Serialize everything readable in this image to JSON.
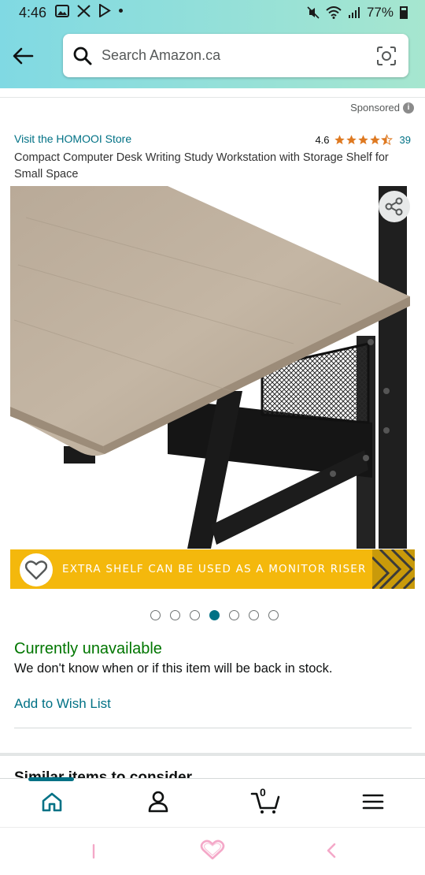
{
  "status_bar": {
    "time": "4:46",
    "battery": "77%",
    "left_icons": [
      "gallery-icon",
      "x-icon",
      "play-store-icon",
      "dot-icon"
    ],
    "right_icons": [
      "mute-icon",
      "wifi-icon",
      "signal-icon",
      "battery-icon"
    ]
  },
  "search": {
    "placeholder": "Search Amazon.ca"
  },
  "sponsored_label": "Sponsored",
  "product": {
    "store_link": "Visit the HOMOOI Store",
    "rating_value": "4.6",
    "rating_stars": 4.5,
    "rating_count": "39",
    "title": "Compact Computer Desk Writing Study Workstation with Storage Shelf for Small Space",
    "banner_text": "EXTRA SHELF CAN BE USED AS A MONITOR RISER",
    "image_count": 7,
    "active_image_index": 3
  },
  "availability": {
    "status": "Currently unavailable",
    "message": "We don't know when or if this item will be back in stock."
  },
  "actions": {
    "wish_list": "Add to Wish List"
  },
  "next_section_title": "Similar items to consider",
  "bottom_nav": {
    "items": [
      "home-icon",
      "account-icon",
      "cart-icon",
      "menu-icon"
    ],
    "cart_count": "0"
  },
  "colors": {
    "link": "#007185",
    "available_green": "#007600",
    "star": "#de7921",
    "banner": "#f4b80c",
    "header_gradient_start": "#80d9e3",
    "header_gradient_end": "#a6e6cf"
  }
}
